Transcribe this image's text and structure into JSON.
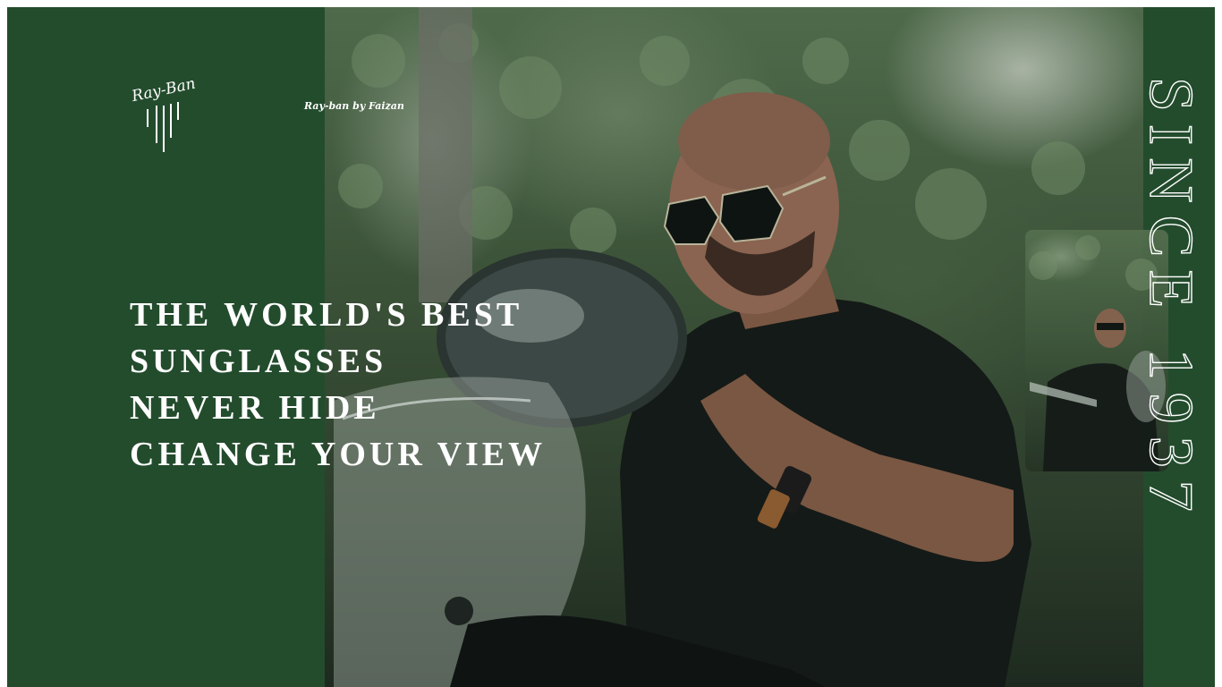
{
  "brand": {
    "logo_text": "Ray-Ban",
    "credit": "Ray-ban by Faizan"
  },
  "hero": {
    "headline_lines": [
      "THE WORLD'S BEST",
      "SUNGLASSES",
      "NEVER HIDE",
      "CHANGE YOUR VIEW"
    ],
    "since_text": "SINCE 1937"
  },
  "colors": {
    "panel_green": "#234c2d",
    "text": "#ffffff"
  }
}
